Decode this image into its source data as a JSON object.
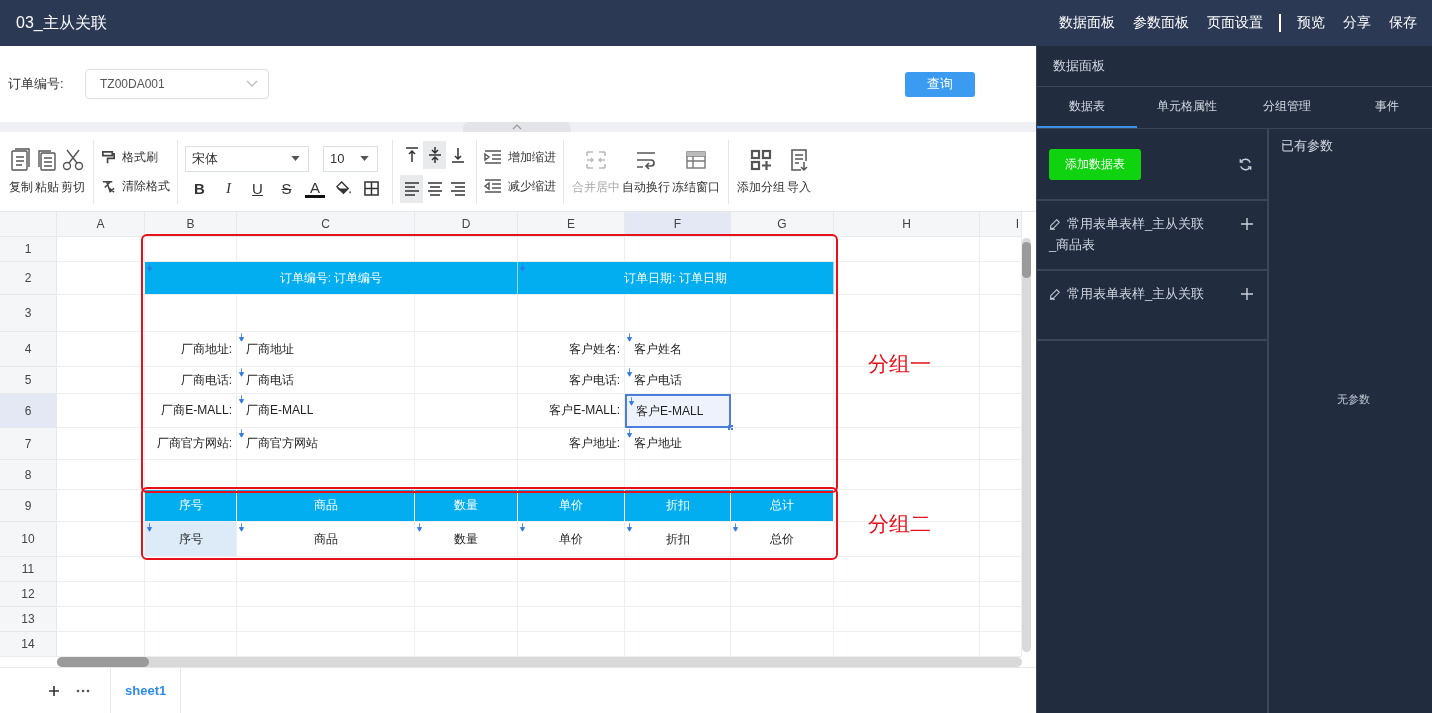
{
  "window": {
    "title": "03_主从关联"
  },
  "top_menu": [
    {
      "label": "数据面板",
      "kind": "link"
    },
    {
      "label": "参数面板",
      "kind": "link"
    },
    {
      "label": "页面设置",
      "kind": "link"
    },
    {
      "kind": "divider"
    },
    {
      "label": "预览",
      "kind": "link"
    },
    {
      "label": "分享",
      "kind": "link"
    },
    {
      "label": "保存",
      "kind": "link"
    }
  ],
  "query": {
    "label": "订单编号:",
    "value": "TZ00DA001",
    "button": "查询"
  },
  "toolbar": {
    "groups": [
      {
        "kind": "big",
        "items": [
          {
            "label": "复制",
            "kind": "copy",
            "disabled": false
          },
          {
            "label": "粘贴",
            "kind": "paste",
            "disabled": false
          },
          {
            "label": "剪切",
            "kind": "cut",
            "disabled": false
          }
        ]
      },
      {
        "kind": "small",
        "items": [
          {
            "label": "格式刷",
            "kind": "brush"
          },
          {
            "label": "清除格式",
            "kind": "clear"
          }
        ]
      },
      {
        "kind": "font",
        "font": "宋体",
        "size": "10",
        "buttons": [
          {
            "label": "B",
            "kind": "bold"
          },
          {
            "label": "I",
            "kind": "italic"
          },
          {
            "label": "U",
            "kind": "underline"
          },
          {
            "label": "S",
            "kind": "strike"
          },
          {
            "label": "A",
            "kind": "color"
          },
          {
            "kind": "fill"
          },
          {
            "kind": "border"
          }
        ]
      },
      {
        "kind": "align",
        "items": [
          {
            "kind": "top",
            "selected": false
          },
          {
            "kind": "middle",
            "selected": true
          },
          {
            "kind": "bottom",
            "selected": false
          },
          {
            "kind": "left",
            "selected": true
          },
          {
            "kind": "center",
            "selected": false
          },
          {
            "kind": "right",
            "selected": false
          }
        ]
      },
      {
        "kind": "small",
        "items": [
          {
            "label": "增加缩进",
            "kind": "indent"
          },
          {
            "label": "减少缩进",
            "kind": "outdent"
          }
        ]
      },
      {
        "kind": "big",
        "items": [
          {
            "label": "合并居中",
            "kind": "merge",
            "disabled": true
          },
          {
            "label": "自动换行",
            "kind": "wrap",
            "disabled": false
          },
          {
            "label": "冻结窗口",
            "kind": "freeze",
            "disabled": false
          }
        ]
      },
      {
        "kind": "big",
        "items": [
          {
            "label": "添加分组",
            "kind": "group",
            "disabled": false
          },
          {
            "label": "导入",
            "kind": "import",
            "disabled": false
          }
        ]
      }
    ]
  },
  "sheet": {
    "columns": [
      "A",
      "B",
      "C",
      "D",
      "E",
      "F",
      "G",
      "H",
      "I"
    ],
    "blocks": [
      {
        "group": {
          "label": "分组一"
        },
        "rows": [
          {
            "number": "1"
          },
          {
            "number": "2",
            "cells": [
              {
                "kind": "blank"
              },
              {
                "kind": "title",
                "text": "订单编号: 订单编号",
                "selected": false
              },
              {
                "kind": "merged"
              },
              {
                "kind": "merged"
              },
              {
                "kind": "title",
                "text": "订单日期: 订单日期",
                "selected": false
              },
              {
                "kind": "merged"
              },
              {
                "kind": "merged"
              }
            ]
          },
          {
            "number": "3"
          },
          {
            "number": "4",
            "cells": [
              {
                "kind": "blank"
              },
              {
                "kind": "label",
                "text": "厂商地址:",
                "selected": false
              },
              {
                "kind": "field",
                "text": "厂商地址",
                "selected": false
              },
              {
                "kind": "blank"
              },
              {
                "kind": "label",
                "text": "客户姓名:",
                "selected": false
              },
              {
                "kind": "field",
                "text": "客户姓名",
                "selected": false
              }
            ]
          },
          {
            "number": "5",
            "cells": [
              {
                "kind": "blank"
              },
              {
                "kind": "label",
                "text": "厂商电话:",
                "selected": false
              },
              {
                "kind": "field",
                "text": "厂商电话",
                "selected": false
              },
              {
                "kind": "blank"
              },
              {
                "kind": "label",
                "text": "客户电话:",
                "selected": false
              },
              {
                "kind": "field",
                "text": "客户电话",
                "selected": false
              }
            ]
          },
          {
            "number": "6",
            "cells": [
              {
                "kind": "blank"
              },
              {
                "kind": "label",
                "text": "厂商E-MALL:",
                "selected": false
              },
              {
                "kind": "field",
                "text": "厂商E-MALL",
                "selected": false
              },
              {
                "kind": "blank"
              },
              {
                "kind": "label",
                "text": "客户E-MALL:",
                "selected": false
              },
              {
                "kind": "field",
                "text": "客户E-MALL",
                "selected": true
              }
            ]
          },
          {
            "number": "7",
            "cells": [
              {
                "kind": "blank"
              },
              {
                "kind": "label",
                "text": "厂商官方网站:",
                "selected": false
              },
              {
                "kind": "field",
                "text": "厂商官方网站",
                "selected": false
              },
              {
                "kind": "blank"
              },
              {
                "kind": "label",
                "text": "客户地址:",
                "selected": false
              },
              {
                "kind": "field",
                "text": "客户地址",
                "selected": false
              }
            ]
          },
          {
            "number": "8"
          }
        ]
      },
      {
        "group": {
          "label": "分组二"
        },
        "rows": [
          {
            "number": "9",
            "cells": [
              {
                "kind": "blank"
              },
              {
                "kind": "header",
                "text": "序号",
                "selected": false
              },
              {
                "kind": "header",
                "text": "商品",
                "selected": false
              },
              {
                "kind": "header",
                "text": "数量",
                "selected": false
              },
              {
                "kind": "header",
                "text": "单价",
                "selected": false
              },
              {
                "kind": "header",
                "text": "折扣",
                "selected": false
              },
              {
                "kind": "header",
                "text": "总计",
                "selected": false
              }
            ]
          },
          {
            "number": "10",
            "cells": [
              {
                "kind": "blank"
              },
              {
                "kind": "detail",
                "text": "序号",
                "selected": false,
                "highlighted": true
              },
              {
                "kind": "detail",
                "text": "商品",
                "selected": false
              },
              {
                "kind": "detail",
                "text": "数量",
                "selected": false
              },
              {
                "kind": "detail",
                "text": "单价",
                "selected": false
              },
              {
                "kind": "detail",
                "text": "折扣",
                "selected": false
              },
              {
                "kind": "detail",
                "text": "总价",
                "selected": false
              }
            ]
          }
        ]
      },
      {
        "rows": [
          {
            "number": "11"
          },
          {
            "number": "12"
          },
          {
            "number": "13"
          },
          {
            "number": "14"
          }
        ]
      }
    ]
  },
  "sheet_tabs": [
    {
      "label": "sheet1",
      "selected": true
    }
  ],
  "panel": {
    "title": "数据面板",
    "tabs": [
      {
        "label": "数据表",
        "selected": true
      },
      {
        "label": "单元格属性",
        "selected": false
      },
      {
        "label": "分组管理",
        "selected": false
      },
      {
        "label": "事件",
        "selected": false
      }
    ],
    "add_button": "添加数据表",
    "datasets": [
      {
        "name": "常用表单表样_主从关联_商品表"
      },
      {
        "name": "常用表单表样_主从关联"
      }
    ],
    "params_title": "已有参数",
    "params_empty": "无参数"
  }
}
